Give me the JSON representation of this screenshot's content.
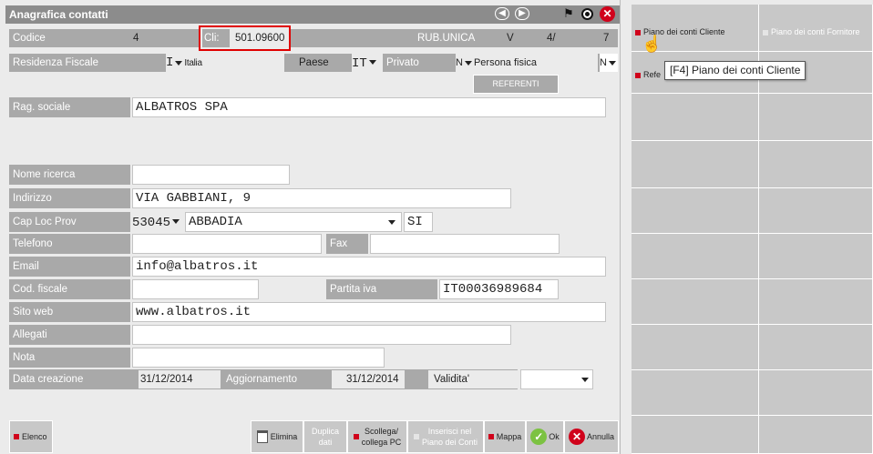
{
  "window": {
    "title": "Anagrafica contatti"
  },
  "header": {
    "codice_label": "Codice",
    "codice_value": "4",
    "cli_label": "Cli:",
    "cli_value": "501.09600",
    "rubrica_label": "RUB.UNICA",
    "rubrica_v": "V",
    "rubrica_num": "4/",
    "rubrica_total": "7"
  },
  "residenza": {
    "label": "Residenza Fiscale",
    "code": "I",
    "value": "Italia",
    "paese_label": "Paese",
    "paese_code": "IT",
    "privato_label": "Privato",
    "privato_code": "N",
    "privato_value": "Persona fisica",
    "privato_extra": "N"
  },
  "referenti_button": "REFERENTI",
  "fields": {
    "rag_sociale_label": "Rag. sociale",
    "rag_sociale": "ALBATROS SPA",
    "nome_ricerca_label": "Nome ricerca",
    "nome_ricerca": "",
    "indirizzo_label": "Indirizzo",
    "indirizzo": "VIA GABBIANI, 9",
    "cap_label": "Cap Loc Prov",
    "cap": "53045",
    "localita": "ABBADIA",
    "prov": "SI",
    "telefono_label": "Telefono",
    "telefono": "",
    "fax_label": "Fax",
    "fax": "",
    "email_label": "Email",
    "email": "info@albatros.it",
    "cod_fiscale_label": "Cod. fiscale",
    "cod_fiscale": "",
    "partita_iva_label": "Partita iva",
    "partita_iva": "IT00036989684",
    "sito_label": "Sito web",
    "sito": "www.albatros.it",
    "allegati_label": "Allegati",
    "allegati": "",
    "nota_label": "Nota",
    "nota": "",
    "data_creazione_label": "Data creazione",
    "data_creazione": "31/12/2014",
    "aggiornamento_label": "Aggiornamento",
    "aggiornamento": "31/12/2014",
    "validita_label": "Validita'",
    "validita": ""
  },
  "footer": {
    "elenco": "Elenco",
    "elimina": "Elimina",
    "duplica_1": "Duplica",
    "duplica_2": "dati",
    "scollega_1": "Scollega/",
    "scollega_2": "collega PC",
    "inserisci_1": "Inserisci nel",
    "inserisci_2": "Piano dei Conti",
    "mappa": "Mappa",
    "ok": "Ok",
    "annulla": "Annulla"
  },
  "side_panel": {
    "piano_cliente": "Piano dei conti Cliente",
    "piano_fornitore": "Piano dei conti Fornitore",
    "referenti_short": "Refe",
    "tooltip": "[F4] Piano dei conti Cliente"
  },
  "colors": {
    "title_bar": "#8c8c8c",
    "label_bg": "#a9a9a9",
    "accent_red": "#d0021b",
    "ok_green": "#7cc242"
  }
}
